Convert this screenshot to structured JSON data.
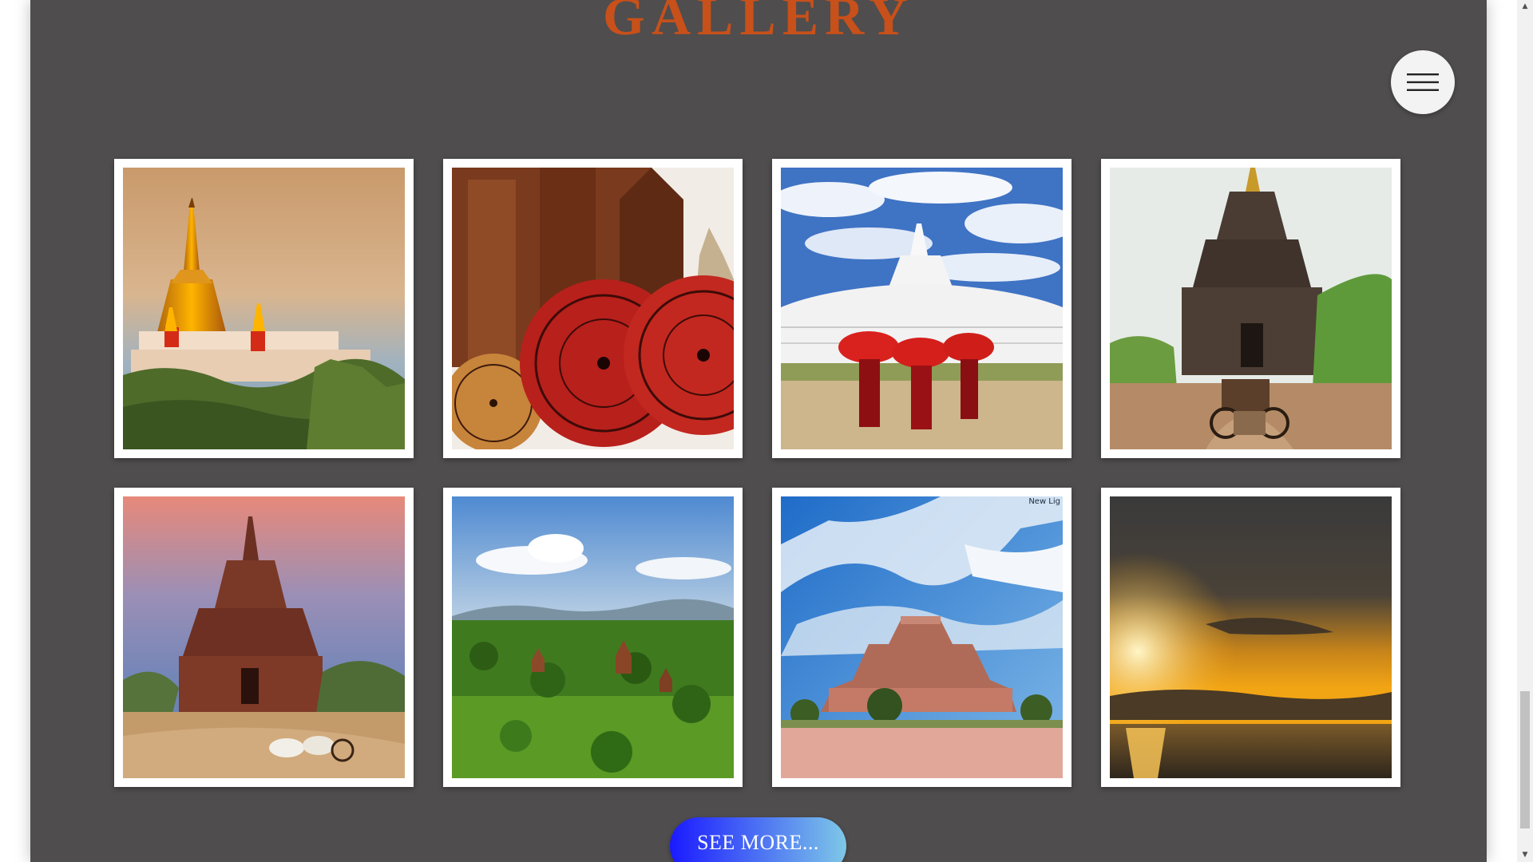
{
  "gallery": {
    "title": "GALLERY",
    "title_color": "#c8501a",
    "panel_color": "#4f4d4d"
  },
  "menu": {
    "icon": "hamburger-menu-icon"
  },
  "images": [
    {
      "subject": "golden-pagoda-hill"
    },
    {
      "subject": "red-parasols-temple"
    },
    {
      "subject": "white-pagoda-monks-umbrellas"
    },
    {
      "subject": "temple-horse-cart"
    },
    {
      "subject": "red-temple-ox-cart"
    },
    {
      "subject": "green-plain-temples"
    },
    {
      "subject": "ruined-temple-blue-sky",
      "watermark": "New Lig"
    },
    {
      "subject": "golden-sunset-river"
    }
  ],
  "button": {
    "label": "SEE MORE...",
    "gradient_start": "#1a1aff",
    "gradient_end": "#7ec8e8"
  },
  "scrollbar": {
    "up_arrow": "▲",
    "down_arrow": "▼"
  }
}
